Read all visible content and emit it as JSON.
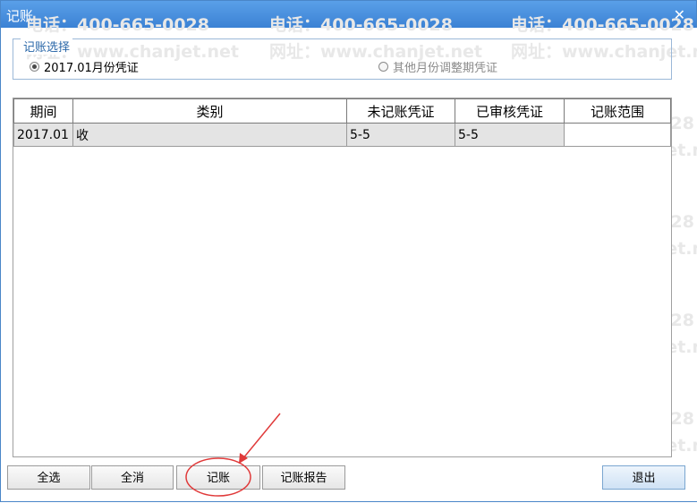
{
  "window": {
    "title": "记账",
    "close_icon": "close-icon"
  },
  "watermark": {
    "line1": "电话：400-665-0028",
    "line2": "网址：www.chanjet.net"
  },
  "selection": {
    "legend": "记账选择",
    "option1": "2017.01月份凭证",
    "option2": "其他月份调整期凭证",
    "selected": "option1"
  },
  "table": {
    "columns": [
      "期间",
      "类别",
      "未记账凭证",
      "已审核凭证",
      "记账范围"
    ],
    "rows": [
      [
        "2017.01",
        "收",
        "5-5",
        "5-5",
        ""
      ]
    ]
  },
  "buttons": {
    "select_all": "全选",
    "clear_all": "全消",
    "post": "记账",
    "report": "记账报告",
    "exit": "退出"
  },
  "annotation": {
    "color": "#e03a3a"
  }
}
